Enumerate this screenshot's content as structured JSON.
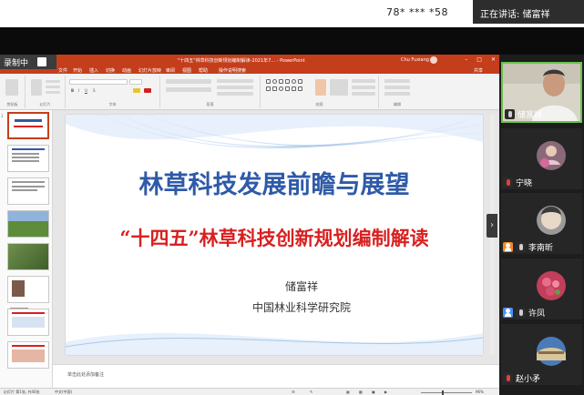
{
  "meeting": {
    "id_masked": "78* *** *58",
    "speaker_label": "正在讲话: 储富祥"
  },
  "recording": {
    "label": "录制中"
  },
  "ppt": {
    "window_title": "\"十四五\"林草科技创新规划编制解读-2021年7... - PowerPoint",
    "user_name": "Chu Fuxiang",
    "tabs": [
      "文件",
      "开始",
      "插入",
      "切换",
      "动画",
      "幻灯片放映",
      "审阅",
      "视图",
      "帮助",
      "操作说明搜索",
      "共享"
    ],
    "ribbon_groups": [
      "剪贴板",
      "幻灯片",
      "字体",
      "段落",
      "绘图",
      "编辑"
    ],
    "notes_placeholder": "单击此处添加备注",
    "status_left": "幻灯片 第1张, 共40张",
    "status_lang": "中文(中国)",
    "zoom": "96%"
  },
  "slide": {
    "title": "林草科技发展前瞻与展望",
    "subtitle": "“十四五”林草科技创新规划编制解读",
    "author": "储富祥",
    "organization": "中国林业科学研究院"
  },
  "participants": [
    {
      "name": "储富祥",
      "speaking": true,
      "badge": "mic",
      "muted": false
    },
    {
      "name": "宁晓",
      "speaking": false,
      "badge": "mic",
      "muted": true
    },
    {
      "name": "李南昕",
      "speaking": false,
      "badge": "person-orange",
      "muted": false
    },
    {
      "name": "许凤",
      "speaking": false,
      "badge": "person-blue",
      "muted": false
    },
    {
      "name": "赵小矛",
      "speaking": false,
      "badge": "mic",
      "muted": true
    }
  ],
  "colors": {
    "ppt_accent": "#c43e1c",
    "title_blue": "#2e5aa8",
    "subtitle_red": "#d92020",
    "speaking_border": "#6ac24d"
  }
}
